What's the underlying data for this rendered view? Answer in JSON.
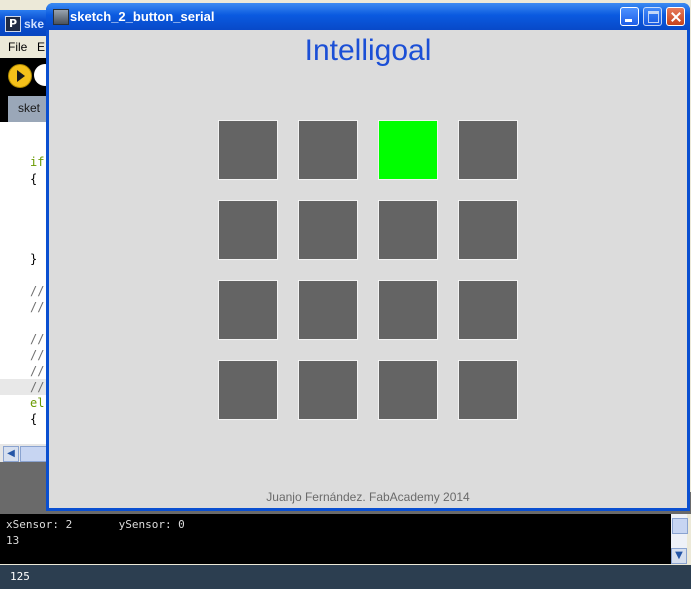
{
  "ide": {
    "logo": "P",
    "title_fragment": "ske",
    "menu": [
      "File",
      "E"
    ],
    "tab_label": "sket",
    "code": [
      "if",
      "{",
      "}",
      "//",
      "//",
      "//",
      "//",
      "//",
      "//",
      "el",
      "{"
    ],
    "console_lines": [
      "xSensor: 2       ySensor: 0",
      "13"
    ],
    "status_line": "125"
  },
  "sketch": {
    "window_title": "sketch_2_button_serial",
    "app_title": "Intelligoal",
    "grid": {
      "rows": 4,
      "columns": 4,
      "active_cell": {
        "row": 1,
        "column": 3
      }
    },
    "colors": {
      "cell": "#646464",
      "active": "#00ff00",
      "title": "#1b4fd6",
      "background": "#dcdcdc"
    },
    "credits": "Juanjo Fernández. FabAcademy 2014"
  }
}
